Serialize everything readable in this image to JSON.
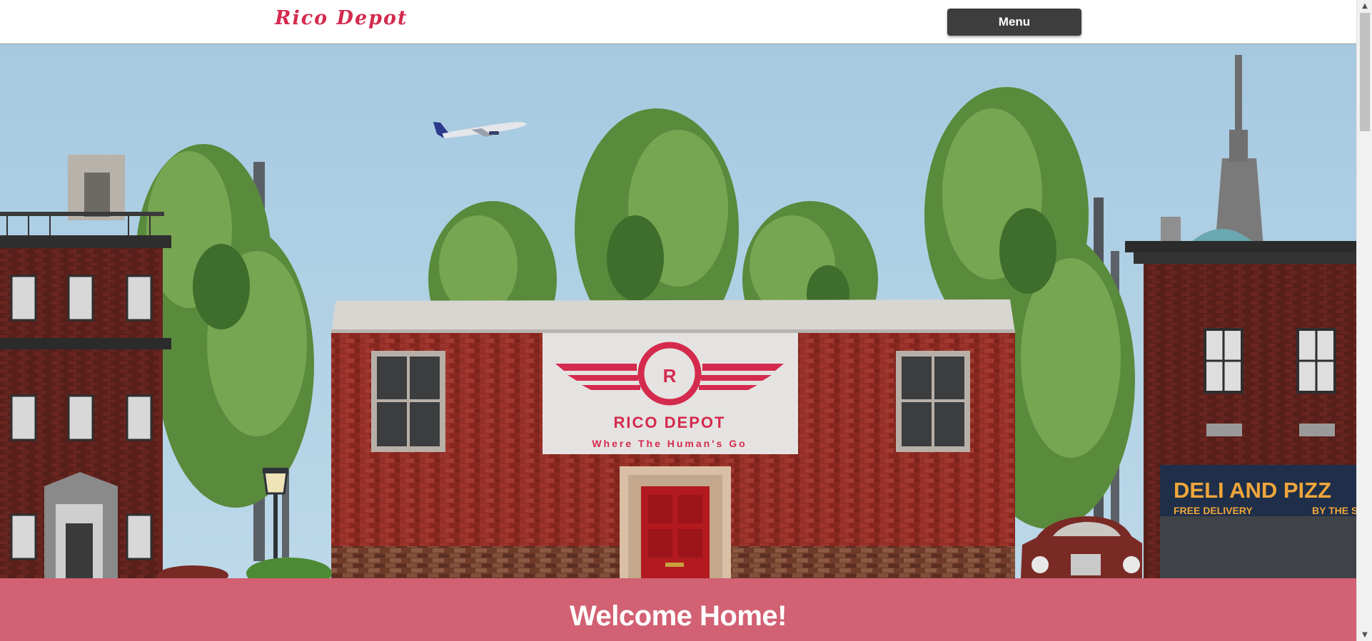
{
  "header": {
    "brand": "Rico Depot",
    "menu_label": "Menu"
  },
  "hero": {
    "sign": {
      "initial": "R",
      "name": "RICO DEPOT",
      "tagline": "Where The Human's Go"
    },
    "deli_sign": {
      "title": "DELI AND PIZZ",
      "subtitle_left": "FREE DELIVERY",
      "subtitle_right": "BY THE S"
    }
  },
  "welcome": {
    "heading": "Welcome Home!"
  },
  "colors": {
    "brand": "#d42a4e",
    "menu_button": "#3d3d3d",
    "welcome_band": "#d26173",
    "sky": "#a9cde3",
    "brick": "#8e2a24"
  },
  "scrollbar": {
    "up_icon": "triangle-up-icon",
    "down_icon": "triangle-down-icon"
  }
}
